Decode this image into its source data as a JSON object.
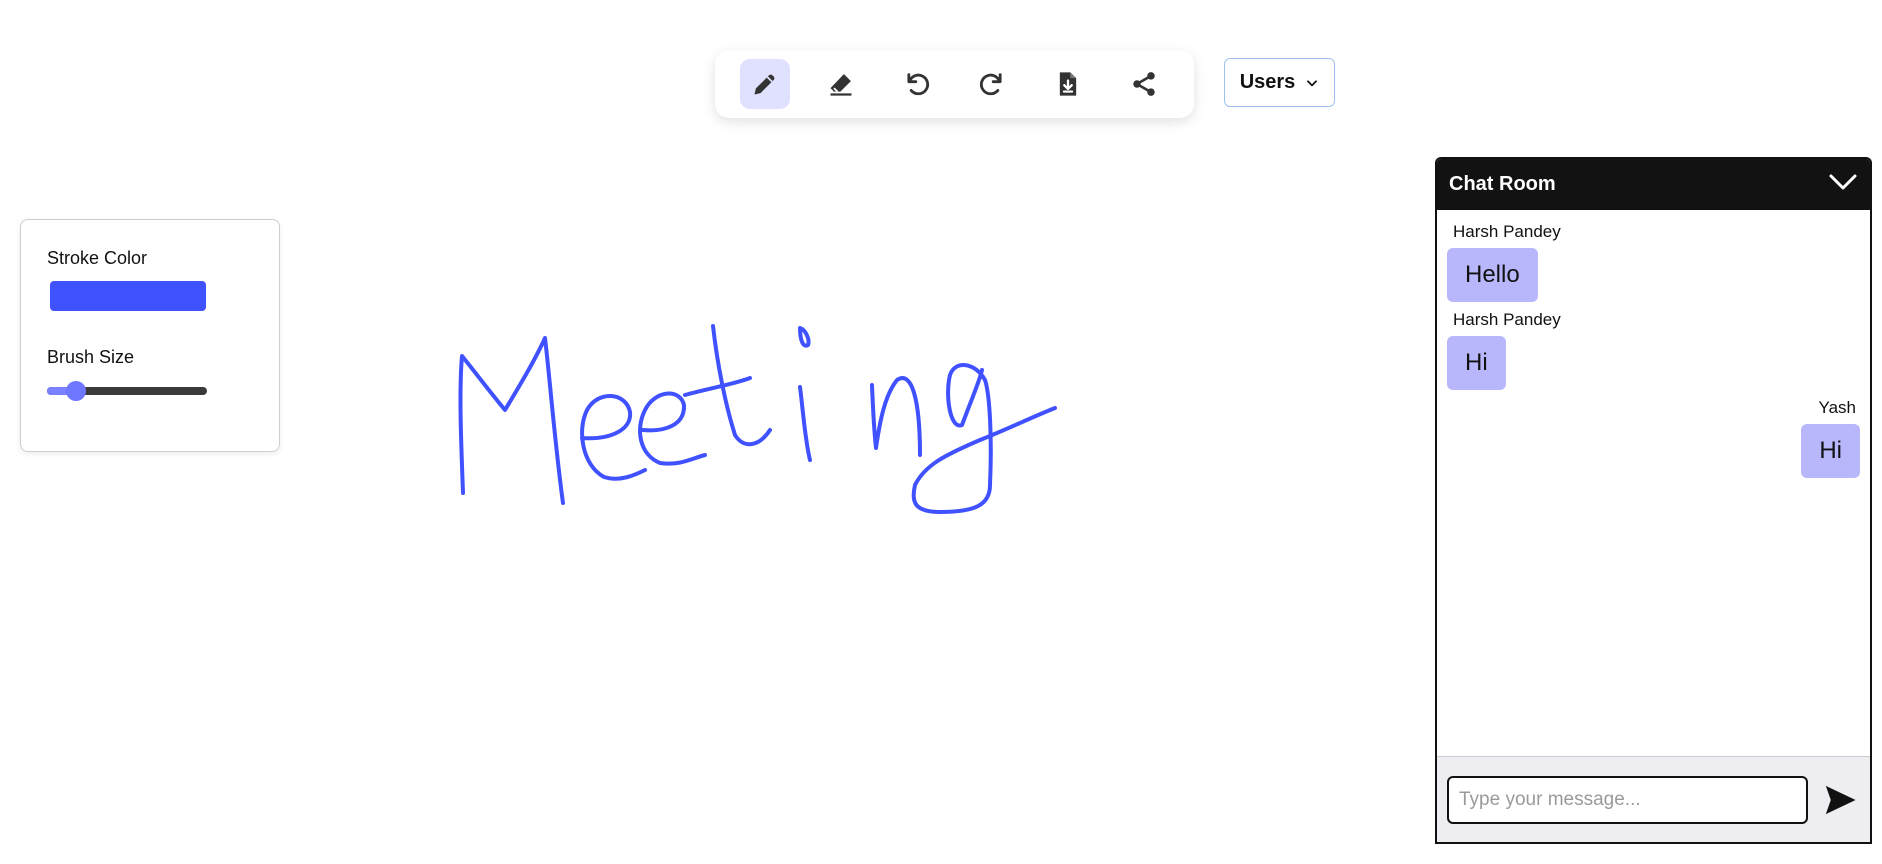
{
  "toolbar": {
    "tools": [
      {
        "icon": "pencil-icon",
        "active": true
      },
      {
        "icon": "eraser-icon",
        "active": false
      },
      {
        "icon": "undo-icon",
        "active": false
      },
      {
        "icon": "redo-icon",
        "active": false
      },
      {
        "icon": "download-file-icon",
        "active": false
      },
      {
        "icon": "share-icon",
        "active": false
      }
    ],
    "users_label": "Users"
  },
  "stroke_panel": {
    "stroke_color_label": "Stroke Color",
    "stroke_color": "#4051ff",
    "brush_size_label": "Brush Size",
    "brush_size_fraction": 0.18
  },
  "chat": {
    "title": "Chat Room",
    "messages": [
      {
        "sender": "Harsh Pandey",
        "text": "Hello",
        "side": "left"
      },
      {
        "sender": "Harsh Pandey",
        "text": "Hi",
        "side": "left"
      },
      {
        "sender": "Yash",
        "text": "Hi",
        "side": "right"
      }
    ],
    "input_placeholder": "Type your message...",
    "input_value": ""
  },
  "colors": {
    "accent": "#4051ff",
    "bubble": "#b9b7fb",
    "active_tool_bg": "#e0e1ff",
    "chat_header": "#121212"
  }
}
